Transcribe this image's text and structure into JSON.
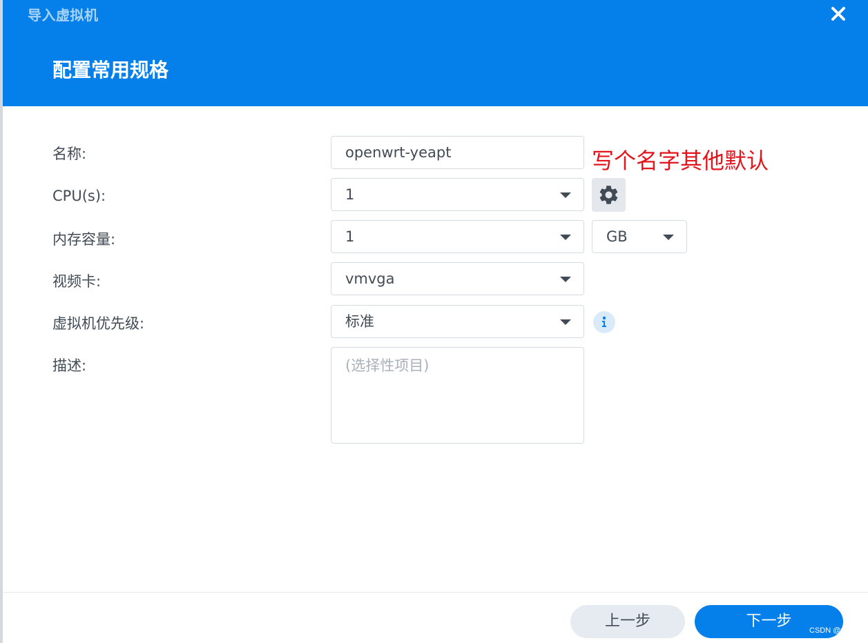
{
  "window": {
    "title": "导入虚拟机",
    "step_title": "配置常用规格"
  },
  "form": {
    "name": {
      "label": "名称:",
      "value": "openwrt-yeapt"
    },
    "cpu": {
      "label": "CPU(s):",
      "value": "1"
    },
    "memory": {
      "label": "内存容量:",
      "value": "1",
      "unit": "GB"
    },
    "video_card": {
      "label": "视频卡:",
      "value": "vmvga"
    },
    "priority": {
      "label": "虚拟机优先级:",
      "value": "标准"
    },
    "description": {
      "label": "描述:",
      "placeholder": "(选择性项目)"
    }
  },
  "annotation": "写个名字其他默认",
  "footer": {
    "prev_label": "上一步",
    "next_label": "下一步"
  },
  "watermark": "CSDN @yeapT",
  "colors": {
    "accent": "#0580ea",
    "annotation": "#e2141c"
  },
  "icons": [
    "close-icon",
    "gear-icon",
    "info-icon",
    "chevron-down-icon"
  ]
}
